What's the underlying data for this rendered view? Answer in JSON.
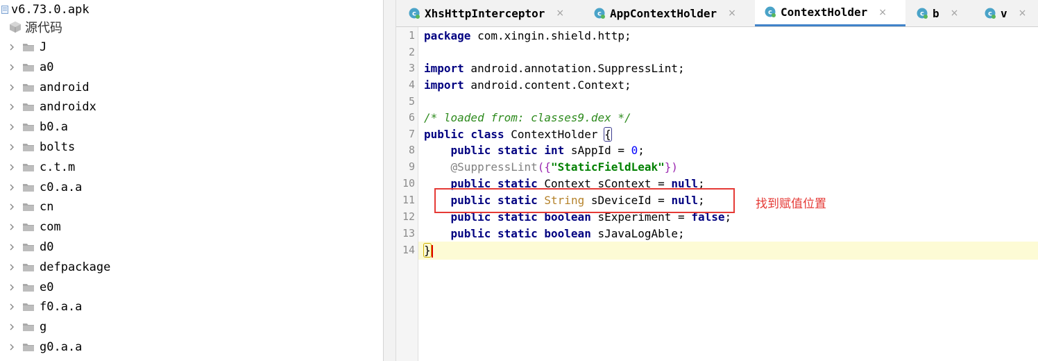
{
  "tree": {
    "root_label": "v6.73.0.apk",
    "source_label": "源代码",
    "items": [
      "J",
      "a0",
      "android",
      "androidx",
      "b0.a",
      "bolts",
      "c.t.m",
      "c0.a.a",
      "cn",
      "com",
      "d0",
      "defpackage",
      "e0",
      "f0.a.a",
      "g",
      "g0.a.a"
    ]
  },
  "tabs": [
    {
      "label": "XhsHttpInterceptor",
      "close": "×"
    },
    {
      "label": "AppContextHolder",
      "close": "×"
    },
    {
      "label": "ContextHolder",
      "close": "×"
    },
    {
      "label": "b",
      "close": "×"
    },
    {
      "label": "v",
      "close": "×"
    }
  ],
  "editor": {
    "line_numbers": [
      "1",
      "2",
      "3",
      "4",
      "5",
      "6",
      "7",
      "8",
      "9",
      "10",
      "11",
      "12",
      "13",
      "14"
    ],
    "code": {
      "l1": {
        "kw": "package",
        "rest": " com.xingin.shield.http;"
      },
      "l3": {
        "kw": "import",
        "rest": " android.annotation.SuppressLint;"
      },
      "l4": {
        "kw": "import",
        "rest": " android.content.Context;"
      },
      "l6": {
        "comment": "/* loaded from: classes9.dex */"
      },
      "l7": {
        "kw": "public class",
        "name": " ContextHolder ",
        "brace": "{"
      },
      "l8": {
        "kw": "public static int",
        "name": " sAppId = ",
        "num": "0",
        "end": ";"
      },
      "l9": {
        "at": "@",
        "ann": "SuppressLint",
        "paren_open": "({",
        "str": "\"StaticFieldLeak\"",
        "paren_close": "})"
      },
      "l10": {
        "kw": "public static",
        "name": " Context sContext = ",
        "kw2": "null",
        "end": ";"
      },
      "l11": {
        "kw": "public static",
        "sp": " ",
        "type": "String",
        "name": " sDeviceId = ",
        "kw2": "null",
        "end": ";"
      },
      "l12": {
        "kw": "public static boolean",
        "name": " sExperiment = ",
        "kw2": "false",
        "end": ";"
      },
      "l13": {
        "kw": "public static boolean",
        "name": " sJavaLogAble;"
      },
      "l14": {
        "brace": "}"
      }
    },
    "annotation_note": "找到赋值位置"
  },
  "colors": {
    "keyword": "#000080",
    "comment": "#2e8b1e",
    "number": "#0000ff",
    "string": "#008000",
    "annotation_box": "#e53935",
    "active_tab_underline": "#4083c9",
    "current_line": "#fdfbd5"
  },
  "icons": {
    "tree_chevron": "chevron-right-icon",
    "tree_folder": "folder-icon",
    "tab_class": "java-class-icon"
  }
}
